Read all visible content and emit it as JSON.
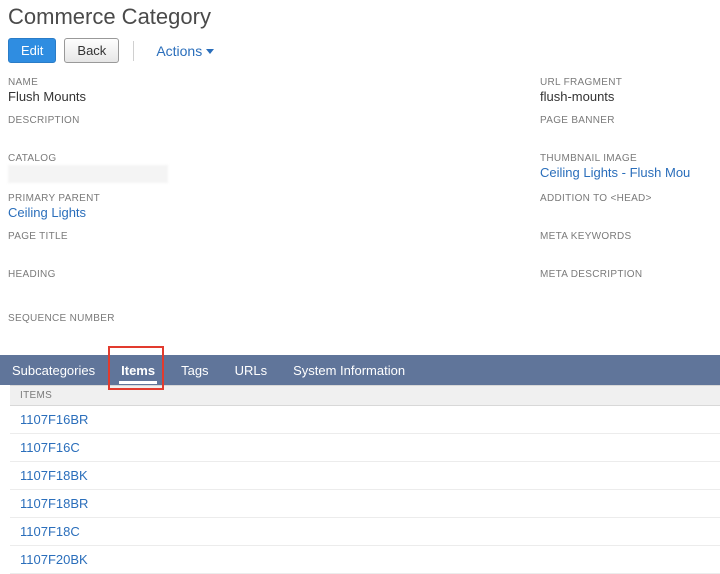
{
  "header": {
    "title": "Commerce Category",
    "edit_label": "Edit",
    "back_label": "Back",
    "actions_label": "Actions"
  },
  "fields": {
    "name": {
      "label": "NAME",
      "value": "Flush Mounts"
    },
    "url_fragment": {
      "label": "URL FRAGMENT",
      "value": "flush-mounts"
    },
    "description": {
      "label": "DESCRIPTION",
      "value": ""
    },
    "page_banner": {
      "label": "PAGE BANNER",
      "value": ""
    },
    "catalog": {
      "label": "CATALOG",
      "value": ""
    },
    "thumbnail": {
      "label": "THUMBNAIL IMAGE",
      "value": "Ceiling Lights - Flush Mou"
    },
    "primary_parent": {
      "label": "PRIMARY PARENT",
      "value": "Ceiling Lights"
    },
    "addition_head": {
      "label": "ADDITION TO <HEAD>",
      "value": ""
    },
    "page_title": {
      "label": "PAGE TITLE",
      "value": ""
    },
    "meta_keywords": {
      "label": "META KEYWORDS",
      "value": ""
    },
    "heading": {
      "label": "HEADING",
      "value": ""
    },
    "meta_description": {
      "label": "META DESCRIPTION",
      "value": ""
    },
    "sequence_number": {
      "label": "SEQUENCE NUMBER",
      "value": ""
    }
  },
  "tabs": [
    {
      "label": "Subcategories"
    },
    {
      "label": "Items"
    },
    {
      "label": "Tags"
    },
    {
      "label": "URLs"
    },
    {
      "label": "System Information"
    }
  ],
  "items_header": "ITEMS",
  "items": [
    "1107F16BR",
    "1107F16C",
    "1107F18BK",
    "1107F18BR",
    "1107F18C",
    "1107F20BK"
  ]
}
